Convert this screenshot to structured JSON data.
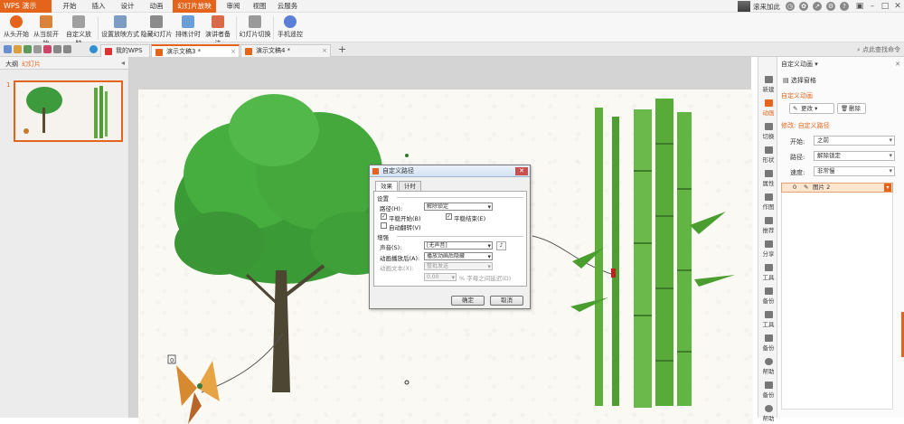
{
  "app": {
    "name": "WPS 演示"
  },
  "menu": {
    "tabs": [
      "开始",
      "插入",
      "设计",
      "动画",
      "幻灯片放映",
      "审阅",
      "视图",
      "云服务"
    ],
    "active_index": 4
  },
  "user": {
    "name": "滚来加此"
  },
  "ribbon": {
    "buttons": [
      "从头开始",
      "从当前开始",
      "自定义放映",
      "设置放映方式",
      "隐藏幻灯片",
      "排练计时",
      "演讲者备注",
      "幻灯片切换",
      "手机遥控"
    ]
  },
  "doc_tabs": [
    {
      "label": "我的WPS",
      "active": false
    },
    {
      "label": "演示文稿3 *",
      "active": true
    },
    {
      "label": "演示文稿4 *",
      "active": false
    }
  ],
  "search": {
    "placeholder": "点此查找命令"
  },
  "left_panel": {
    "tab_outline": "大纲",
    "tab_slides": "幻灯片",
    "slide_number": "1"
  },
  "slide": {
    "trigger_number": "0"
  },
  "dialog": {
    "title": "自定义路径",
    "tabs": [
      "效果",
      "计时"
    ],
    "group_settings": "设置",
    "path_label": "路径(H):",
    "path_value": "解除锁定",
    "smooth_start": "平稳开始(B)",
    "smooth_end": "平稳结束(E)",
    "auto_reverse": "自动翻转(V)",
    "group_enhance": "增强",
    "sound_label": "声音(S):",
    "sound_value": "[无声音]",
    "after_label": "动画播放后(A):",
    "after_value": "播放动画后隐藏",
    "text_label": "动画文本(X):",
    "text_value": "整批发送",
    "delay_value": "0.00",
    "delay_suffix": "% 字母之间延迟(D)",
    "ok": "确定",
    "cancel": "取消"
  },
  "side_strip": {
    "items": [
      "新建",
      "动画",
      "切换",
      "形状",
      "属性",
      "作图",
      "推荐",
      "分享",
      "工具",
      "备份",
      "工具",
      "备份",
      "帮助",
      "备份",
      "帮助"
    ]
  },
  "right_panel": {
    "title": "自定义动画",
    "select_pane": "选择窗格",
    "section_custom": "自定义动画",
    "change_btn": "更改",
    "delete_btn": "删除",
    "section_modify": "修改: 自定义路径",
    "start_label": "开始:",
    "start_value": "之前",
    "path_label": "路径:",
    "path_value": "解除锁定",
    "speed_label": "速度:",
    "speed_value": "非常慢",
    "item_index": "0",
    "item_label": "图片 2"
  },
  "colors": {
    "accent": "#e4641c",
    "tree_green": "#2f8f2f",
    "bamboo_green": "#4fae3a",
    "annotation_red": "#e0201e"
  }
}
